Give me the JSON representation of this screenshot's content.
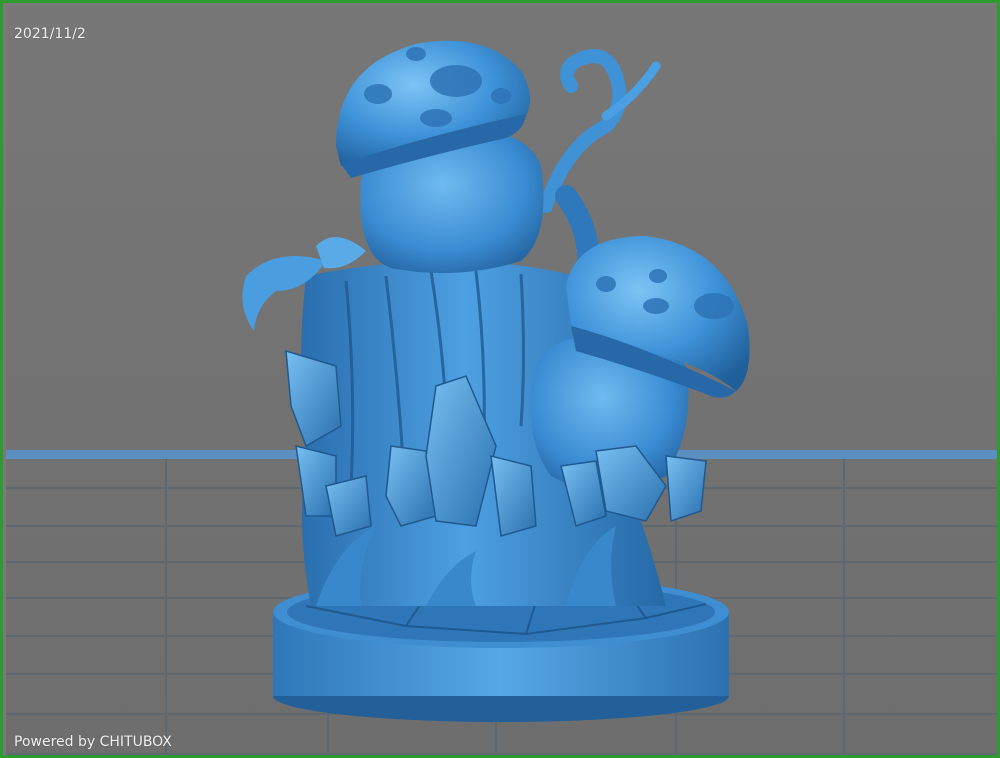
{
  "viewer": {
    "date": "2021/11/2",
    "powered_by": "Powered by CHITUBOX"
  },
  "colors": {
    "background": "#7a7a7a",
    "frame": "#2f9a2f",
    "grid_line": "#5f6a73",
    "grid_accent": "#5a8fbf",
    "model_main": "#3d8fd6",
    "model_light": "#62b0ee",
    "model_dark": "#1f5f9a"
  }
}
